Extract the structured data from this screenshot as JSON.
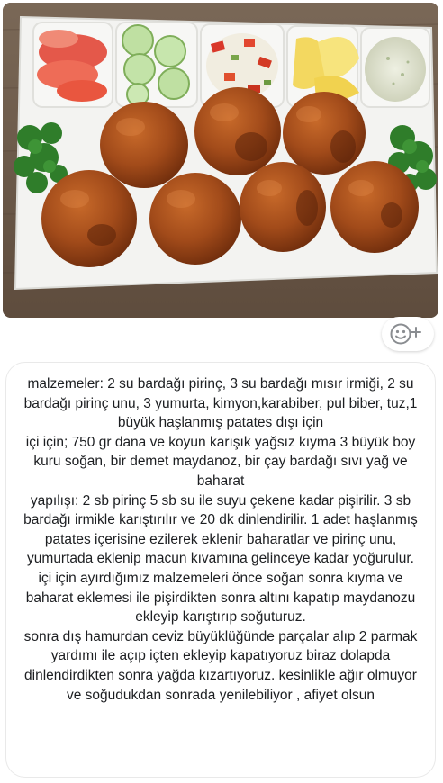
{
  "photo": {
    "description_icon": "food-photo"
  },
  "reaction": {
    "icon": "add-reaction-icon",
    "glyph": "+"
  },
  "message": {
    "text": "malzemeler: 2 su bardağı pirinç, 3 su bardağı mısır irmiği, 2 su bardağı pirinç unu, 3 yumurta, kimyon,karabiber, pul biber, tuz,1 büyük haşlanmış patates dışı için\niçi için; 750 gr dana ve koyun karışık yağsız kıyma 3 büyük boy kuru soğan, bir demet maydanoz, bir çay bardağı sıvı yağ ve baharat\nyapılışı: 2 sb pirinç 5 sb su ile suyu çekene kadar pişirilir. 3 sb bardağı irmikle karıştırılır ve 20 dk dinlendirilir. 1 adet haşlanmış patates içerisine ezilerek eklenir baharatlar ve pirinç unu, yumurtada eklenip macun kıvamına gelinceye kadar yoğurulur.\niçi için ayırdığımız malzemeleri önce soğan sonra kıyma ve baharat eklemesi ile pişirdikten sonra altını kapatıp maydanozu ekleyip karıştırıp soğuturuz.\nsonra dış hamurdan ceviz büyüklüğünde parçalar alıp  2 parmak yardımı ile açıp içten ekleyip kapatıyoruz biraz dolapda dinlendirdikten sonra yağda kızartıyoruz. kesinlikle ağır olmuyor ve soğudukdan sonrada yenilebiliyor , afiyet olsun"
  }
}
